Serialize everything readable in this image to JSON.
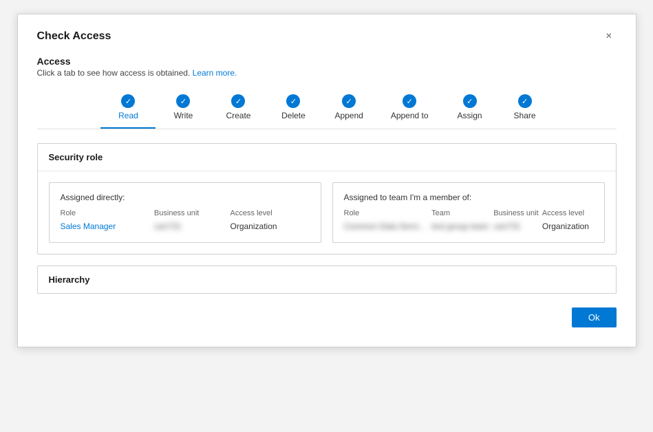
{
  "dialog": {
    "title": "Check Access",
    "close_label": "×"
  },
  "access": {
    "heading": "Access",
    "subtext": "Click a tab to see how access is obtained.",
    "learn_more": "Learn more."
  },
  "tabs": [
    {
      "id": "read",
      "label": "Read",
      "active": true
    },
    {
      "id": "write",
      "label": "Write",
      "active": false
    },
    {
      "id": "create",
      "label": "Create",
      "active": false
    },
    {
      "id": "delete",
      "label": "Delete",
      "active": false
    },
    {
      "id": "append",
      "label": "Append",
      "active": false
    },
    {
      "id": "append_to",
      "label": "Append to",
      "active": false
    },
    {
      "id": "assign",
      "label": "Assign",
      "active": false
    },
    {
      "id": "share",
      "label": "Share",
      "active": false
    }
  ],
  "security_role": {
    "heading": "Security role",
    "assigned_directly": {
      "title": "Assigned directly:",
      "columns": [
        "Role",
        "Business unit",
        "Access level"
      ],
      "rows": [
        {
          "role_part1": "Sales",
          "role_part2": "Manager",
          "business_unit": "can731",
          "access_level": "Organization"
        }
      ]
    },
    "assigned_team": {
      "title": "Assigned to team I'm a member of:",
      "columns": [
        "Role",
        "Team",
        "Business unit",
        "Access level"
      ],
      "rows": [
        {
          "role": "Common Data Servi...",
          "team": "test group team",
          "business_unit": "can731",
          "access_level": "Organization"
        }
      ]
    }
  },
  "hierarchy": {
    "heading": "Hierarchy"
  },
  "footer": {
    "ok_label": "Ok"
  }
}
